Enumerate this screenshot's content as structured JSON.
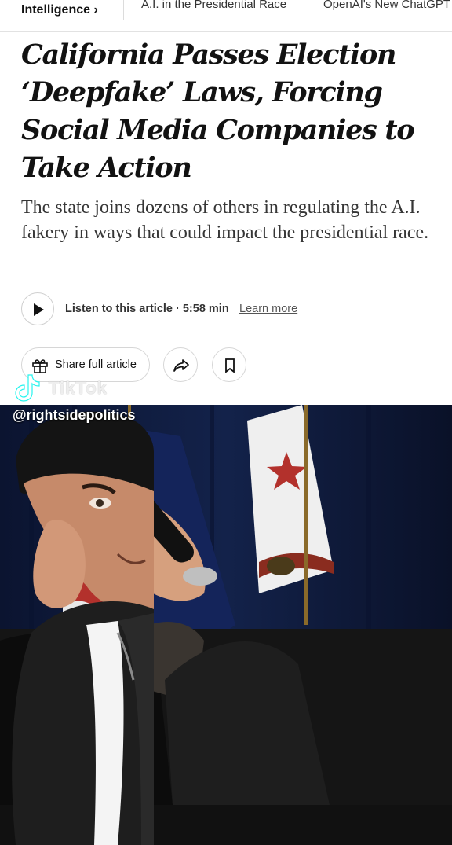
{
  "nav": {
    "section": "Intelligence ›",
    "links": [
      "A.I. in the Presidential Race",
      "OpenAI's New ChatGPT"
    ]
  },
  "article": {
    "headline": "California Passes Election ‘Deepfake’ Laws, Forcing Social Media Companies to Take Action",
    "summary": "The state joins dozens of others in regulating the A.I. fakery in ways that could impact the presidential race.",
    "listen_label": "Listen to this article · 5:58 min",
    "learn_more": "Learn more",
    "share_label": "Share full article"
  },
  "watermark": {
    "brand": "TikTok",
    "handle": "@rightsidepolitics"
  },
  "colors": {
    "headline": "#121212",
    "summary": "#363636",
    "curtain": "#0f1a3a",
    "flag_red": "#b3312c",
    "jacket": "#1e1e1e"
  }
}
